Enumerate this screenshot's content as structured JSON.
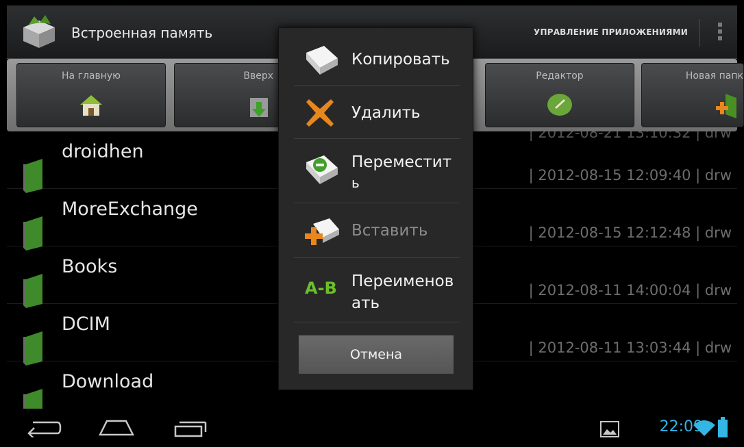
{
  "actionbar": {
    "title": "Встроенная память",
    "manage_apps": "УПРАВЛЕНИЕ ПРИЛОЖЕНИЯМИ"
  },
  "toolbar": {
    "buttons": [
      {
        "label": "На главную"
      },
      {
        "label": "Вверх"
      },
      {
        "label": "Редактор"
      },
      {
        "label": "Новая папк"
      }
    ]
  },
  "files": {
    "partial_meta": "| 2012-08-21 13:10:32 | drw",
    "rows": [
      {
        "name": "droidhen",
        "meta": "| 2012-08-15 12:09:40 | drw"
      },
      {
        "name": "MoreExchange",
        "meta": "| 2012-08-15 12:12:48 | drw"
      },
      {
        "name": "Books",
        "meta": "| 2012-08-11 14:00:04 | drw"
      },
      {
        "name": "DCIM",
        "meta": "| 2012-08-11 13:03:44 | drw"
      },
      {
        "name": "Download",
        "meta": ""
      }
    ]
  },
  "dialog": {
    "items": [
      {
        "label": "Копировать",
        "icon": "copy-icon",
        "enabled": true
      },
      {
        "label": "Удалить",
        "icon": "delete-icon",
        "enabled": true
      },
      {
        "label_line1": "Переместит",
        "label_line2": "ь",
        "icon": "move-icon",
        "enabled": true
      },
      {
        "label": "Вставить",
        "icon": "paste-icon",
        "enabled": false
      },
      {
        "label_line1": "Переименов",
        "label_line2": "ать",
        "icon": "rename-icon",
        "enabled": true
      }
    ],
    "cancel": "Отмена"
  },
  "systembar": {
    "time": "22:09"
  },
  "colors": {
    "accent": "#33b5e5",
    "folder": "#3f8a2a",
    "delete_orange": "#e8871e"
  }
}
